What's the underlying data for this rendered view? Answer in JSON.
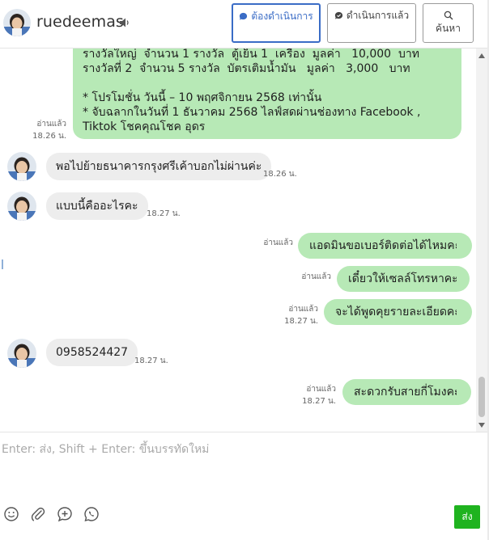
{
  "header": {
    "name": "ruedeemas",
    "buttons": {
      "pending": "ต้องดำเนินการ",
      "done": "ดำเนินการแล้ว",
      "search": "ค้นหา"
    }
  },
  "messages": {
    "promo": {
      "text": "รางวัลใหญ่  จำนวน 1 รางวัล  ตู้เย็น 1  เครื่อง  มูลค่า   10,000  บาท\nรางวัลที่ 2  จำนวน 5 รางวัล  บัตรเติมน้ำมัน   มูลค่า   3,000   บาท\n\n* โปรโมชั่น วันนี้ – 10 พฤศจิกายน 2568 เท่านั้น\n* จับฉลากในวันที่ 1 ธันวาคม 2568 ไลฟ์สดผ่านช่องทาง Facebook , Tiktok โชคคุณโชค อุดร",
      "read": "อ่านแล้ว",
      "time": "18.26 น."
    },
    "in1": {
      "text": "พอไปย้ายธนาคารกรุงศรีเค้าบอกไม่ผ่านค่ะ",
      "time": "18.26 น."
    },
    "in2": {
      "text": "แบบนี้คืออะไรคะ",
      "time": "18.27 น."
    },
    "out1": {
      "text": "แอดมินขอเบอร์ติดต่อได้ไหมคะ",
      "read": "อ่านแล้ว"
    },
    "out2": {
      "text": "เดี๋ยวให้เซลล์โทรหาคะ",
      "read": "อ่านแล้ว"
    },
    "out3": {
      "text": "จะได้พูดคุยรายละเอียดคะ",
      "read": "อ่านแล้ว",
      "time": "18.27 น."
    },
    "in3": {
      "text": "0958524427",
      "time": "18.27 น."
    },
    "out4": {
      "text": "สะดวกรับสายกี่โมงคะ",
      "read": "อ่านแล้ว",
      "time": "18.27 น."
    }
  },
  "composer": {
    "placeholder": "Enter: ส่ง, Shift + Enter: ขึ้นบรรทัดใหม่",
    "send_label": "ส่ง"
  },
  "colors": {
    "outgoing_bubble": "#b7e9b6",
    "incoming_bubble": "#ededed",
    "active_button": "#3a6cc6",
    "send_button": "#1fb31f"
  }
}
